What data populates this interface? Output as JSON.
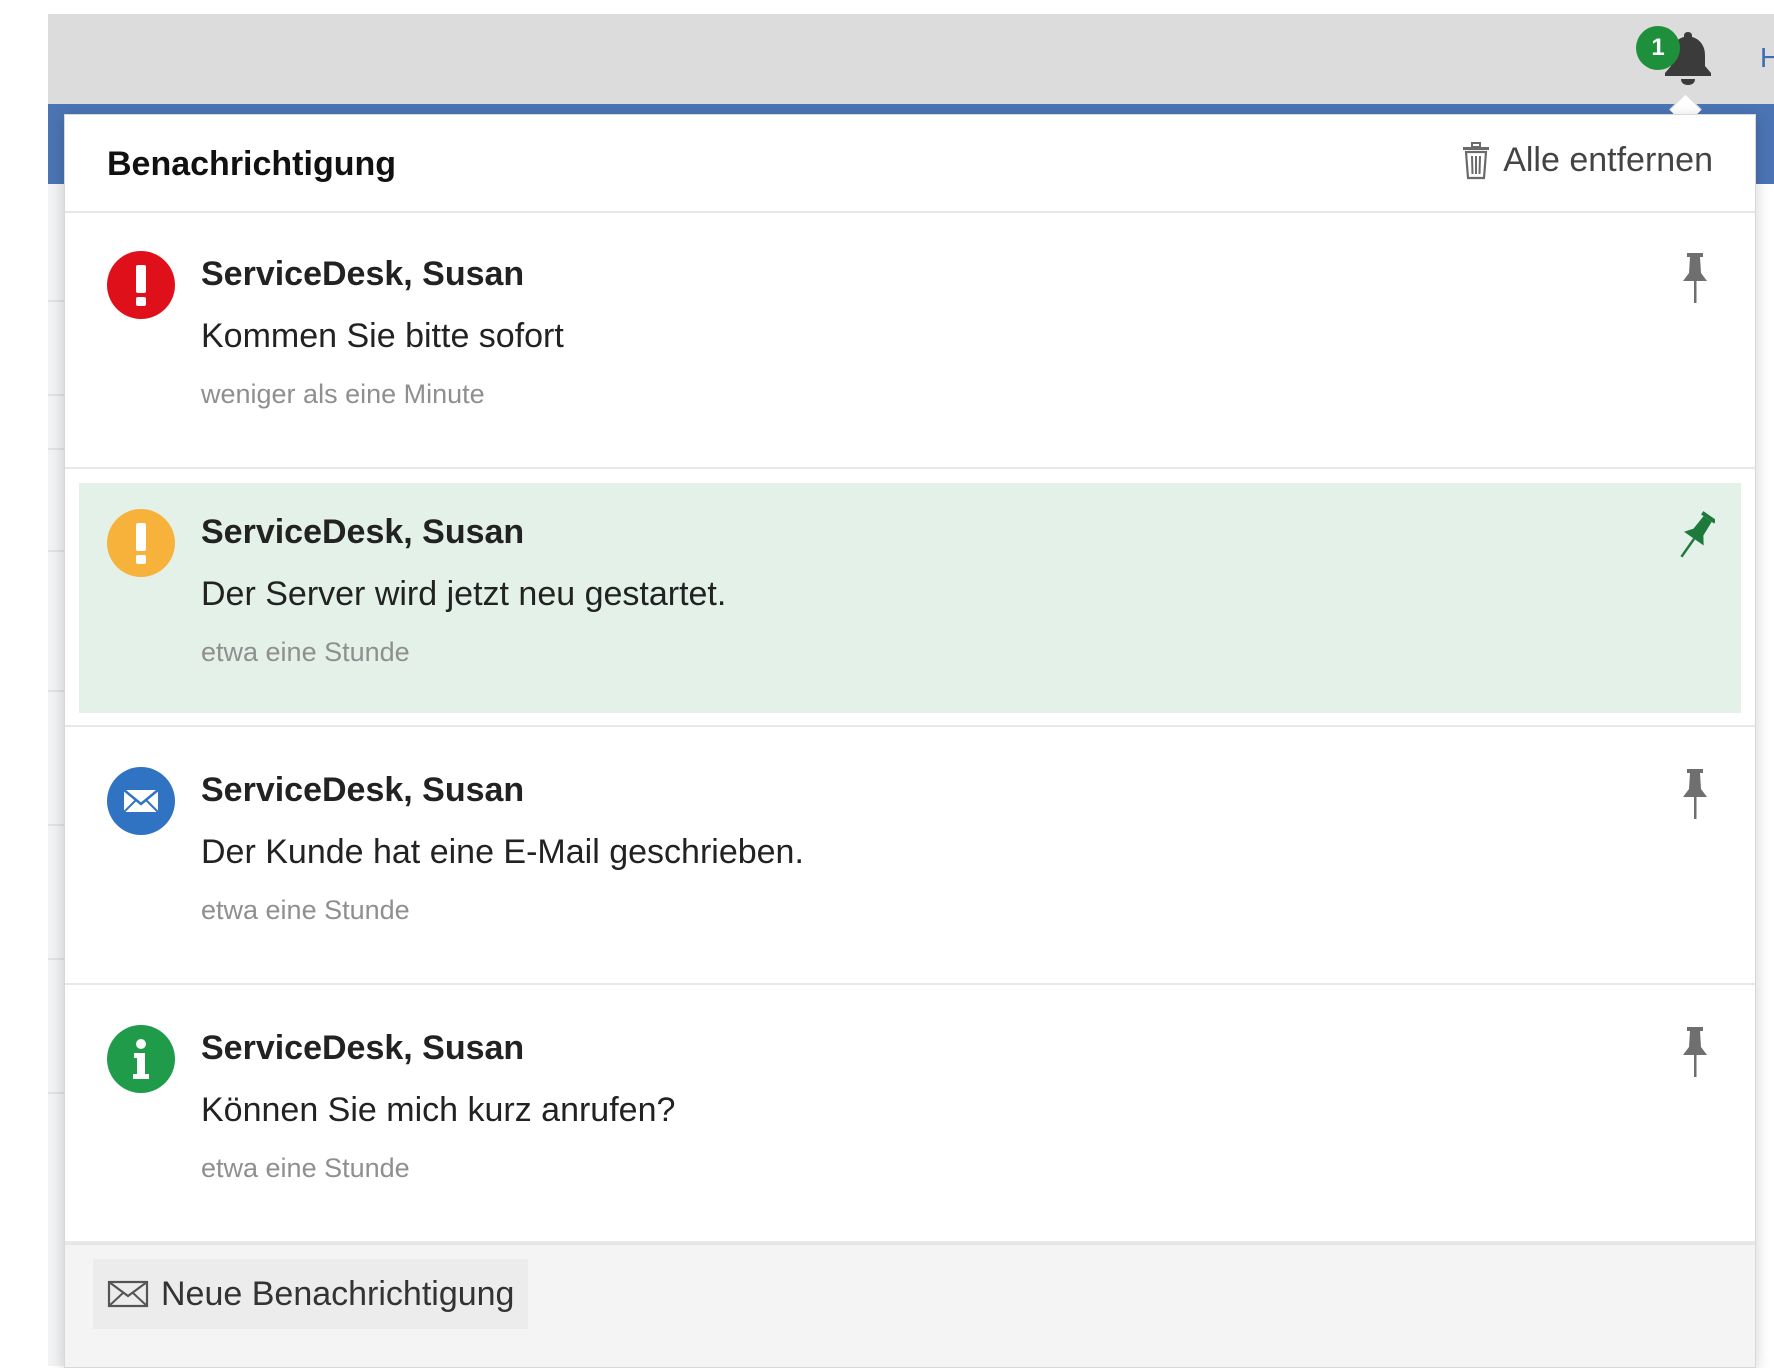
{
  "header": {
    "bell_badge": "1",
    "top_link_fragment": "H"
  },
  "popup": {
    "title": "Benachrichtigung",
    "clear_all_label": "Alle entfernen",
    "new_notification_label": "Neue Benachrichtigung"
  },
  "notifications": [
    {
      "sender": "ServiceDesk, Susan",
      "message": "Kommen Sie bitte sofort",
      "time": "weniger als eine Minute",
      "type": "error",
      "icon": "exclamation-icon",
      "color": "#e0101b",
      "pinned": false
    },
    {
      "sender": "ServiceDesk, Susan",
      "message": "Der Server wird jetzt neu gestartet.",
      "time": "etwa eine Stunde",
      "type": "warning",
      "icon": "exclamation-icon",
      "color": "#f7b23b",
      "pinned": true
    },
    {
      "sender": "ServiceDesk, Susan",
      "message": "Der Kunde hat eine E-Mail geschrieben.",
      "time": "etwa eine Stunde",
      "type": "mail",
      "icon": "envelope-icon",
      "color": "#2f73c2",
      "pinned": false
    },
    {
      "sender": "ServiceDesk, Susan",
      "message": "Können Sie mich kurz anrufen?",
      "time": "etwa eine Stunde",
      "type": "info",
      "icon": "info-icon",
      "color": "#1f9b4a",
      "pinned": false
    }
  ],
  "colors": {
    "highlight_bg": "#e3f1e9",
    "pin_active": "#1e7a3c",
    "pin_inactive": "#6f6f6f",
    "accent_blue": "#4a74b3"
  }
}
